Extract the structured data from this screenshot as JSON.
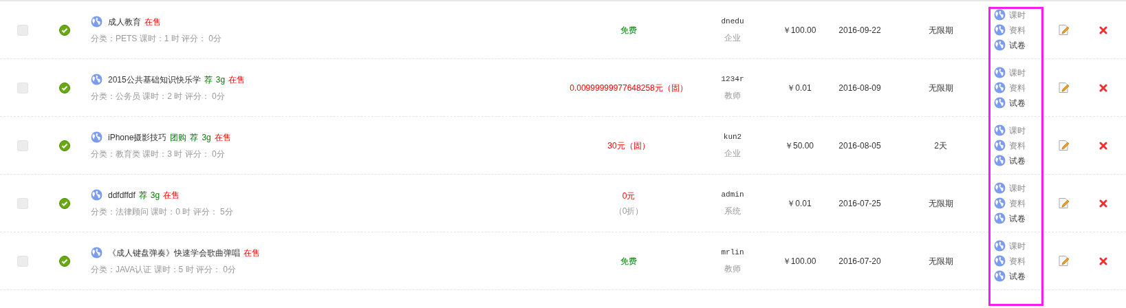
{
  "highlight_links_column": true,
  "rows": [
    {
      "checked": false,
      "approved": true,
      "title": "成人教育",
      "tags": [
        {
          "text": "在售",
          "kind": "status"
        }
      ],
      "meta": "分类：PETS 课时：1 时 评分： 0分",
      "price": {
        "text": "免费",
        "kind": "free"
      },
      "owner": "dnedu",
      "owner_type": "企业",
      "amount": "￥100.00",
      "date": "2016-09-22",
      "period": "无限期",
      "links": [
        {
          "text": "课时",
          "muted": true
        },
        {
          "text": "资料",
          "muted": true
        },
        {
          "text": "试卷",
          "muted": false
        }
      ]
    },
    {
      "checked": false,
      "approved": true,
      "title": "2015公共基础知识快乐学",
      "tags": [
        {
          "text": "荐",
          "kind": "promo"
        },
        {
          "text": "3g",
          "kind": "promo"
        },
        {
          "text": "在售",
          "kind": "status"
        }
      ],
      "meta": "分类：公务员 课时：2 时 评分： 0分",
      "price": {
        "text": "0.00999999977648258元（固）",
        "kind": "paid"
      },
      "owner": "1234r",
      "owner_type": "教师",
      "amount": "￥0.01",
      "date": "2016-08-09",
      "period": "无限期",
      "links": [
        {
          "text": "课时",
          "muted": true
        },
        {
          "text": "资料",
          "muted": true
        },
        {
          "text": "试卷",
          "muted": false
        }
      ]
    },
    {
      "checked": false,
      "approved": true,
      "title": "iPhone摄影技巧",
      "tags": [
        {
          "text": "团购",
          "kind": "promo"
        },
        {
          "text": "荐",
          "kind": "promo"
        },
        {
          "text": "3g",
          "kind": "promo"
        },
        {
          "text": "在售",
          "kind": "status"
        }
      ],
      "meta": "分类：教育类 课时：3 时 评分： 0分",
      "price": {
        "text": "30元（固）",
        "kind": "paid"
      },
      "owner": "kun2",
      "owner_type": "企业",
      "amount": "￥50.00",
      "date": "2016-08-05",
      "period": "2天",
      "links": [
        {
          "text": "课时",
          "muted": true
        },
        {
          "text": "资料",
          "muted": true
        },
        {
          "text": "试卷",
          "muted": false
        }
      ]
    },
    {
      "checked": false,
      "approved": true,
      "title": "ddfdffdf",
      "tags": [
        {
          "text": "荐",
          "kind": "promo"
        },
        {
          "text": "3g",
          "kind": "promo"
        },
        {
          "text": "在售",
          "kind": "status"
        }
      ],
      "meta": "分类：法律顾问 课时：0 时 评分： 5分",
      "price": {
        "text": "0元",
        "kind": "paid",
        "note": "（0折）"
      },
      "owner": "admin",
      "owner_type": "系统",
      "amount": "￥0.01",
      "date": "2016-07-25",
      "period": "无限期",
      "links": [
        {
          "text": "课时",
          "muted": true
        },
        {
          "text": "资料",
          "muted": true
        },
        {
          "text": "试卷",
          "muted": false
        }
      ]
    },
    {
      "checked": false,
      "approved": true,
      "title": "《成人键盘弹奏》快速学会歌曲弹唱",
      "tags": [
        {
          "text": "在售",
          "kind": "status"
        }
      ],
      "meta": "分类：JAVA认证 课时：5 时 评分： 0分",
      "price": {
        "text": "免费",
        "kind": "free"
      },
      "owner": "mrlin",
      "owner_type": "教师",
      "amount": "￥100.00",
      "date": "2016-07-20",
      "period": "无限期",
      "links": [
        {
          "text": "课时",
          "muted": true
        },
        {
          "text": "资料",
          "muted": true
        },
        {
          "text": "试卷",
          "muted": false
        }
      ]
    }
  ]
}
